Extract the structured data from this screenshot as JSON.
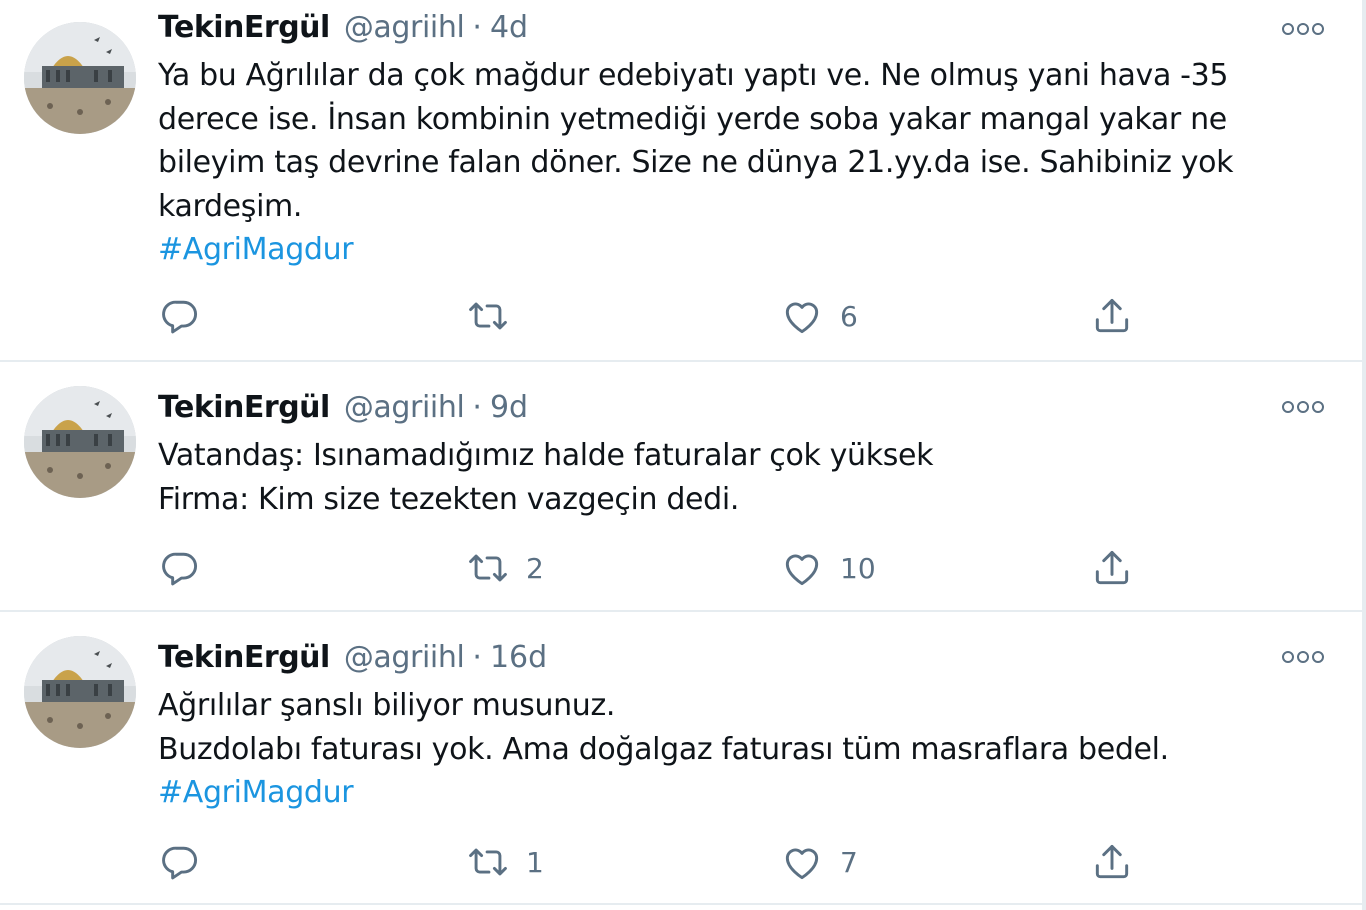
{
  "tweets": [
    {
      "author_name": "TekinErgül",
      "author_handle": "@agriihl",
      "separator": "·",
      "time": "4d",
      "lines": [
        "Ya bu Ağrılılar da çok mağdur edebiyatı yaptı ve. Ne olmuş yani hava -35",
        "derece ise. İnsan kombinin yetmediği yerde soba yakar mangal yakar ne",
        "bileyim taş devrine falan döner. Size ne dünya 21.yy.da ise. Sahibiniz yok",
        "kardeşim."
      ],
      "hashtag": "#AgriMagdur",
      "replies": "",
      "retweets": "",
      "likes": "6"
    },
    {
      "author_name": "TekinErgül",
      "author_handle": "@agriihl",
      "separator": "·",
      "time": "9d",
      "lines": [
        "Vatandaş: Isınamadığımız halde faturalar çok yüksek",
        "Firma: Kim size tezekten vazgeçin dedi."
      ],
      "replies": "",
      "retweets": "2",
      "likes": "10"
    },
    {
      "author_name": "TekinErgül",
      "author_handle": "@agriihl",
      "separator": "·",
      "time": "16d",
      "lines": [
        "Ağrılılar şanslı biliyor musunuz.",
        "Buzdolabı faturası yok. Ama doğalgaz faturası tüm masraflara bedel."
      ],
      "hashtag": "#AgriMagdur",
      "replies": "",
      "retweets": "1",
      "likes": "7"
    }
  ],
  "icons": {
    "reply": "reply-icon",
    "retweet": "retweet-icon",
    "like": "heart-icon",
    "share": "share-icon",
    "more": "more-icon"
  },
  "colors": {
    "text": "#0f1419",
    "secondary": "#5b7083",
    "hashtag": "#1b95e0",
    "divider": "#e6ecf0"
  }
}
